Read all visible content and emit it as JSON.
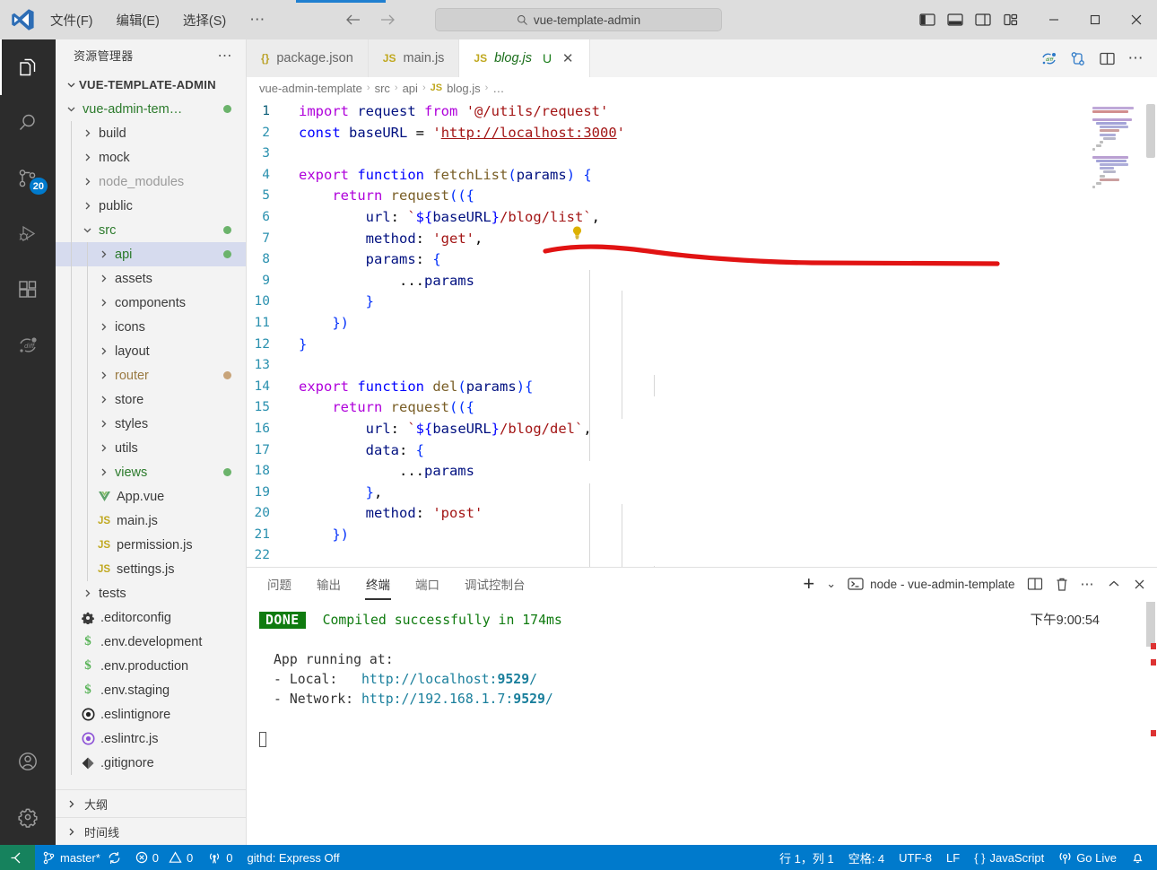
{
  "titlebar": {
    "menus": [
      "文件(F)",
      "编辑(E)",
      "选择(S)",
      "⋯"
    ],
    "back_arrow": "←",
    "forward_arrow": "→",
    "search_placeholder": "vue-template-admin",
    "search_icon": "search-icon",
    "layout_icons": [
      "toggle-primary-sidebar-icon",
      "toggle-panel-icon",
      "toggle-secondary-sidebar-icon",
      "customize-layout-icon"
    ],
    "window_minimize": "−",
    "window_maximize": "□",
    "window_close": "✕"
  },
  "activitybar": {
    "items": [
      {
        "name": "explorer-icon",
        "active": true,
        "badge": ""
      },
      {
        "name": "search-icon",
        "active": false,
        "badge": ""
      },
      {
        "name": "source-control-icon",
        "active": false,
        "badge": "20"
      },
      {
        "name": "run-and-debug-icon",
        "active": false,
        "badge": ""
      },
      {
        "name": "extensions-icon",
        "active": false,
        "badge": ""
      },
      {
        "name": "diff-sync-icon",
        "active": false,
        "badge": ""
      }
    ],
    "bottom": [
      {
        "name": "accounts-icon"
      },
      {
        "name": "settings-gear-icon"
      }
    ]
  },
  "sidebar": {
    "title": "资源管理器",
    "more_actions": "⋯",
    "root": "VUE-TEMPLATE-ADMIN",
    "tree": [
      {
        "label": "vue-admin-tem…",
        "type": "folder",
        "expanded": true,
        "depth": 1,
        "color": "green",
        "dot": "green"
      },
      {
        "label": "build",
        "type": "folder",
        "expanded": false,
        "depth": 2,
        "color": "normal",
        "dot": ""
      },
      {
        "label": "mock",
        "type": "folder",
        "expanded": false,
        "depth": 2,
        "color": "normal",
        "dot": ""
      },
      {
        "label": "node_modules",
        "type": "folder",
        "expanded": false,
        "depth": 2,
        "color": "dim",
        "dot": ""
      },
      {
        "label": "public",
        "type": "folder",
        "expanded": false,
        "depth": 2,
        "color": "normal",
        "dot": ""
      },
      {
        "label": "src",
        "type": "folder",
        "expanded": true,
        "depth": 2,
        "color": "green",
        "dot": "green"
      },
      {
        "label": "api",
        "type": "folder",
        "expanded": false,
        "depth": 3,
        "color": "green",
        "dot": "green",
        "selected": true
      },
      {
        "label": "assets",
        "type": "folder",
        "expanded": false,
        "depth": 3,
        "color": "normal",
        "dot": ""
      },
      {
        "label": "components",
        "type": "folder",
        "expanded": false,
        "depth": 3,
        "color": "normal",
        "dot": ""
      },
      {
        "label": "icons",
        "type": "folder",
        "expanded": false,
        "depth": 3,
        "color": "normal",
        "dot": ""
      },
      {
        "label": "layout",
        "type": "folder",
        "expanded": false,
        "depth": 3,
        "color": "normal",
        "dot": ""
      },
      {
        "label": "router",
        "type": "folder",
        "expanded": false,
        "depth": 3,
        "color": "tan",
        "dot": "tan"
      },
      {
        "label": "store",
        "type": "folder",
        "expanded": false,
        "depth": 3,
        "color": "normal",
        "dot": ""
      },
      {
        "label": "styles",
        "type": "folder",
        "expanded": false,
        "depth": 3,
        "color": "normal",
        "dot": ""
      },
      {
        "label": "utils",
        "type": "folder",
        "expanded": false,
        "depth": 3,
        "color": "normal",
        "dot": ""
      },
      {
        "label": "views",
        "type": "folder",
        "expanded": false,
        "depth": 3,
        "color": "green",
        "dot": "green"
      },
      {
        "label": "App.vue",
        "type": "file",
        "icon": "vue-icon",
        "depth": 3,
        "color": "normal",
        "dot": ""
      },
      {
        "label": "main.js",
        "type": "file",
        "icon": "js-icon",
        "depth": 3,
        "color": "normal",
        "dot": ""
      },
      {
        "label": "permission.js",
        "type": "file",
        "icon": "js-icon",
        "depth": 3,
        "color": "normal",
        "dot": ""
      },
      {
        "label": "settings.js",
        "type": "file",
        "icon": "js-icon",
        "depth": 3,
        "color": "normal",
        "dot": ""
      },
      {
        "label": "tests",
        "type": "folder",
        "expanded": false,
        "depth": 2,
        "color": "normal",
        "dot": ""
      },
      {
        "label": ".editorconfig",
        "type": "file",
        "icon": "gear-icon",
        "depth": 2,
        "color": "normal",
        "dot": ""
      },
      {
        "label": ".env.development",
        "type": "file",
        "icon": "env-icon",
        "depth": 2,
        "color": "normal",
        "dot": ""
      },
      {
        "label": ".env.production",
        "type": "file",
        "icon": "env-icon",
        "depth": 2,
        "color": "normal",
        "dot": ""
      },
      {
        "label": ".env.staging",
        "type": "file",
        "icon": "env-icon",
        "depth": 2,
        "color": "normal",
        "dot": ""
      },
      {
        "label": ".eslintignore",
        "type": "file",
        "icon": "eslint-ignore-icon",
        "depth": 2,
        "color": "normal",
        "dot": ""
      },
      {
        "label": ".eslintrc.js",
        "type": "file",
        "icon": "eslint-icon",
        "depth": 2,
        "color": "normal",
        "dot": ""
      },
      {
        "label": ".gitignore",
        "type": "file",
        "icon": "git-icon",
        "depth": 2,
        "color": "normal",
        "dot": ""
      }
    ],
    "sections": [
      {
        "label": "大纲"
      },
      {
        "label": "时间线"
      }
    ]
  },
  "tabs": {
    "items": [
      {
        "label": "package.json",
        "icon": "json-icon",
        "active": false,
        "preview": false,
        "dirty": ""
      },
      {
        "label": "main.js",
        "icon": "js-icon",
        "active": false,
        "preview": false,
        "dirty": ""
      },
      {
        "label": "blog.js",
        "icon": "js-icon",
        "active": true,
        "preview": true,
        "dirty": "U",
        "close": "✕"
      }
    ],
    "actions": [
      "run-diff-icon",
      "source-control-graph-icon",
      "split-editor-icon",
      "more-actions-icon"
    ]
  },
  "breadcrumb": {
    "parts": [
      "vue-admin-template",
      "src",
      "api",
      "blog.js",
      "…"
    ],
    "file_icon": "js-icon",
    "separator": "›"
  },
  "editor": {
    "file": "blog.js",
    "language": "JavaScript",
    "lightbulb": "quick-fix-lightbulb-icon",
    "annotation": "red-hand-drawn-underline",
    "lines": [
      {
        "n": 1,
        "tokens": [
          [
            "kw2",
            "import"
          ],
          [
            "op",
            " "
          ],
          [
            "var",
            "request"
          ],
          [
            "op",
            " "
          ],
          [
            "kw2",
            "from"
          ],
          [
            "op",
            " "
          ],
          [
            "s",
            "'@/utils/request'"
          ]
        ]
      },
      {
        "n": 2,
        "tokens": [
          [
            "k",
            "const"
          ],
          [
            "op",
            " "
          ],
          [
            "var",
            "baseURL"
          ],
          [
            "op",
            " = "
          ],
          [
            "s",
            "'"
          ],
          [
            "s lnk",
            "http://localhost:3000"
          ],
          [
            "s",
            "'"
          ]
        ]
      },
      {
        "n": 3,
        "tokens": []
      },
      {
        "n": 4,
        "tokens": [
          [
            "kw2",
            "export"
          ],
          [
            "op",
            " "
          ],
          [
            "k",
            "function"
          ],
          [
            "op",
            " "
          ],
          [
            "fn",
            "fetchList"
          ],
          [
            "pn",
            "("
          ],
          [
            "par",
            "params"
          ],
          [
            "pn",
            ")"
          ],
          [
            "op",
            " "
          ],
          [
            "pn",
            "{"
          ]
        ]
      },
      {
        "n": 5,
        "tokens": [
          [
            "op",
            "    "
          ],
          [
            "kw2",
            "return"
          ],
          [
            "op",
            " "
          ],
          [
            "fn",
            "request"
          ],
          [
            "pn",
            "(({"
          ]
        ]
      },
      {
        "n": 6,
        "tokens": [
          [
            "op",
            "        "
          ],
          [
            "var",
            "url"
          ],
          [
            "op",
            ": "
          ],
          [
            "tpl",
            "`"
          ],
          [
            "emb",
            "${"
          ],
          [
            "var",
            "baseURL"
          ],
          [
            "emb",
            "}"
          ],
          [
            "tpl",
            "/blog/list`"
          ],
          [
            "op",
            ","
          ]
        ]
      },
      {
        "n": 7,
        "tokens": [
          [
            "op",
            "        "
          ],
          [
            "var",
            "method"
          ],
          [
            "op",
            ": "
          ],
          [
            "s",
            "'get'"
          ],
          [
            "op",
            ","
          ]
        ]
      },
      {
        "n": 8,
        "tokens": [
          [
            "op",
            "        "
          ],
          [
            "var",
            "params"
          ],
          [
            "op",
            ": "
          ],
          [
            "pn",
            "{"
          ]
        ]
      },
      {
        "n": 9,
        "tokens": [
          [
            "op",
            "            "
          ],
          [
            "op",
            "..."
          ],
          [
            "var",
            "params"
          ]
        ]
      },
      {
        "n": 10,
        "tokens": [
          [
            "op",
            "        "
          ],
          [
            "pn",
            "}"
          ]
        ]
      },
      {
        "n": 11,
        "tokens": [
          [
            "op",
            "    "
          ],
          [
            "pn",
            "}"
          ],
          [
            "pn",
            ")"
          ]
        ]
      },
      {
        "n": 12,
        "tokens": [
          [
            "pn",
            "}"
          ]
        ]
      },
      {
        "n": 13,
        "tokens": []
      },
      {
        "n": 14,
        "tokens": [
          [
            "kw2",
            "export"
          ],
          [
            "op",
            " "
          ],
          [
            "k",
            "function"
          ],
          [
            "op",
            " "
          ],
          [
            "fn",
            "del"
          ],
          [
            "pn",
            "("
          ],
          [
            "par",
            "params"
          ],
          [
            "pn",
            ")"
          ],
          [
            "pn",
            "{"
          ]
        ]
      },
      {
        "n": 15,
        "tokens": [
          [
            "op",
            "    "
          ],
          [
            "kw2",
            "return"
          ],
          [
            "op",
            " "
          ],
          [
            "fn",
            "request"
          ],
          [
            "pn",
            "(({"
          ]
        ]
      },
      {
        "n": 16,
        "tokens": [
          [
            "op",
            "        "
          ],
          [
            "var",
            "url"
          ],
          [
            "op",
            ": "
          ],
          [
            "tpl",
            "`"
          ],
          [
            "emb",
            "${"
          ],
          [
            "var",
            "baseURL"
          ],
          [
            "emb",
            "}"
          ],
          [
            "tpl",
            "/blog/del`"
          ],
          [
            "op",
            ","
          ]
        ]
      },
      {
        "n": 17,
        "tokens": [
          [
            "op",
            "        "
          ],
          [
            "var",
            "data"
          ],
          [
            "op",
            ": "
          ],
          [
            "pn",
            "{"
          ]
        ]
      },
      {
        "n": 18,
        "tokens": [
          [
            "op",
            "            "
          ],
          [
            "op",
            "..."
          ],
          [
            "var",
            "params"
          ]
        ]
      },
      {
        "n": 19,
        "tokens": [
          [
            "op",
            "        "
          ],
          [
            "pn",
            "}"
          ],
          [
            "op",
            ","
          ]
        ]
      },
      {
        "n": 20,
        "tokens": [
          [
            "op",
            "        "
          ],
          [
            "var",
            "method"
          ],
          [
            "op",
            ": "
          ],
          [
            "s",
            "'post'"
          ]
        ]
      },
      {
        "n": 21,
        "tokens": [
          [
            "op",
            "    "
          ],
          [
            "pn",
            "}"
          ],
          [
            "pn",
            ")"
          ]
        ]
      },
      {
        "n": 22,
        "tokens": []
      }
    ]
  },
  "panel": {
    "tabs": [
      {
        "label": "问题",
        "active": false
      },
      {
        "label": "输出",
        "active": false
      },
      {
        "label": "终端",
        "active": true
      },
      {
        "label": "端口",
        "active": false
      },
      {
        "label": "调试控制台",
        "active": false
      }
    ],
    "new_terminal": "+",
    "new_terminal_dropdown": "⌄",
    "terminal_entry_icon": "terminal-icon",
    "terminal_entry": "node - vue-admin-template",
    "actions": [
      "split-terminal-icon",
      "kill-terminal-icon",
      "more-actions-icon",
      "maximize-panel-icon",
      "close-panel-icon"
    ],
    "terminal": {
      "badge": "DONE",
      "compiled": "Compiled successfully in 174ms",
      "time": "下午9:00:54",
      "running_header": "App running at:",
      "local_label": "- Local:",
      "local_url_prefix": "http://localhost:",
      "local_port": "9529",
      "local_url_suffix": "/",
      "network_label": "- Network:",
      "network_url_prefix": "http://192.168.1.7:",
      "network_port": "9529",
      "network_url_suffix": "/"
    }
  },
  "statusbar": {
    "remote_icon": "remote-window-icon",
    "branch": "master*",
    "sync_icon": "sync-icon",
    "errors": "0",
    "warnings": "0",
    "ports": "0",
    "githd": "githd: Express Off",
    "cursor": "行 1，列 1",
    "indent": "空格: 4",
    "encoding": "UTF-8",
    "eol": "LF",
    "language": "JavaScript",
    "golive": "Go Live",
    "bell_icon": "notifications-bell-icon"
  }
}
